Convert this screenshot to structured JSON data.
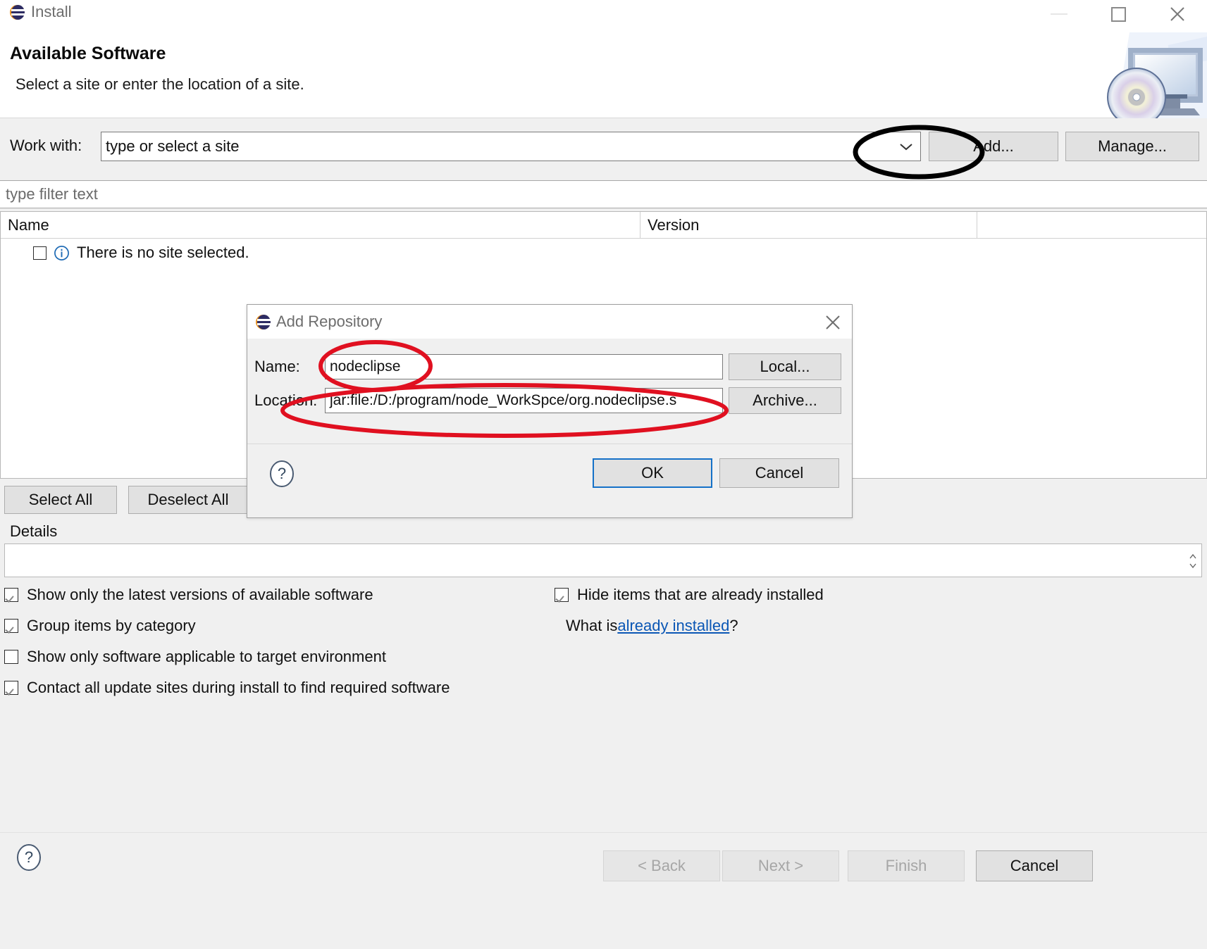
{
  "window": {
    "title": "Install",
    "icon": "eclipse-sphere-icon",
    "controls": {
      "minimize": "minimize-icon",
      "maximize": "maximize-icon",
      "close": "close-icon"
    }
  },
  "banner": {
    "title": "Available Software",
    "subtitle": "Select a site or enter the location of a site.",
    "art": "monitor-cd-icon"
  },
  "work_with": {
    "label": "Work with:",
    "value": "type or select a site",
    "placeholder": "type or select a site",
    "dropdown_icon": "chevron-down-icon",
    "add_label": "Add...",
    "manage_label": "Manage..."
  },
  "filter": {
    "placeholder": "type filter text",
    "value": ""
  },
  "table": {
    "columns": [
      "Name",
      "Version",
      ""
    ],
    "rows": [
      {
        "checked": false,
        "icon": "info-icon",
        "name": "There is no site selected.",
        "version": ""
      }
    ]
  },
  "selection": {
    "select_all": "Select All",
    "deselect_all": "Deselect All"
  },
  "details": {
    "label": "Details",
    "value": ""
  },
  "options": [
    {
      "label": "Show only the latest versions of available software",
      "checked": true
    },
    {
      "label": "Group items by category",
      "checked": true
    },
    {
      "label": "Show only software applicable to target environment",
      "checked": false
    },
    {
      "label": "Contact all update sites during install to find required software",
      "checked": true
    },
    {
      "label": "Hide items that are already installed",
      "checked": true
    }
  ],
  "what_is": {
    "prefix": "What is ",
    "link": "already installed",
    "suffix": "?"
  },
  "footer": {
    "help_icon": "help-circle-icon",
    "back": "< Back",
    "next": "Next >",
    "finish": "Finish",
    "cancel": "Cancel"
  },
  "modal": {
    "title": "Add Repository",
    "icon": "eclipse-sphere-icon",
    "close_icon": "close-icon",
    "name_label": "Name:",
    "name_value": "nodeclipse",
    "location_label": "Location:",
    "location_value": "jar:file:/D:/program/node_WorkSpce/org.nodeclipse.s",
    "local_label": "Local...",
    "archive_label": "Archive...",
    "help_icon": "help-circle-icon",
    "ok_label": "OK",
    "cancel_label": "Cancel"
  },
  "annotations": [
    {
      "name": "add-button-highlight",
      "shape": "ellipse",
      "color": "#000000"
    },
    {
      "name": "name-field-highlight",
      "shape": "ellipse",
      "color": "#e01020"
    },
    {
      "name": "location-field-highlight",
      "shape": "ellipse",
      "color": "#e01020"
    }
  ],
  "colors": {
    "accent": "#0b57b5",
    "focus": "#1571c8",
    "annotation_black": "#000000",
    "annotation_red": "#e01020"
  }
}
